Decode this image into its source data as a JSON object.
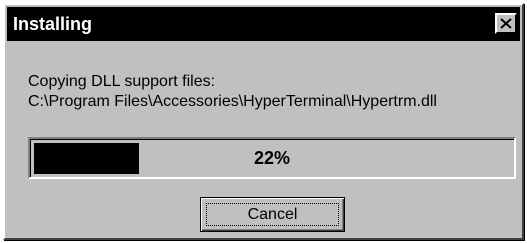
{
  "window": {
    "title": "Installing",
    "close_icon": "close-icon"
  },
  "message": {
    "line1": "Copying DLL support files:",
    "line2": "C:\\Program Files\\Accessories\\HyperTerminal\\Hypertrm.dll"
  },
  "progress": {
    "percent": 22,
    "label": "22%"
  },
  "buttons": {
    "cancel_label": "Cancel"
  },
  "colors": {
    "titlebar": "#000000",
    "face": "#c0c0c0",
    "progress_fill": "#000000"
  }
}
